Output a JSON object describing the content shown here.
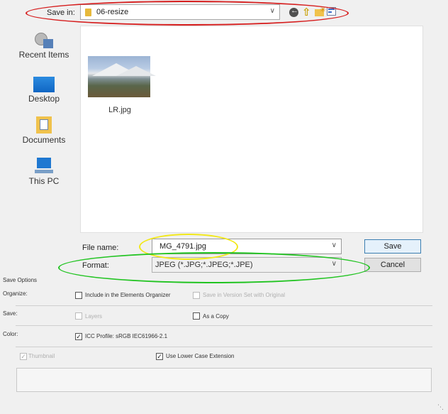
{
  "top": {
    "save_in_label": "Save in:",
    "folder": "06-resize"
  },
  "places": [
    {
      "label": "Recent Items"
    },
    {
      "label": "Desktop"
    },
    {
      "label": "Documents"
    },
    {
      "label": "This PC"
    }
  ],
  "files": [
    {
      "name": "LR.jpg"
    }
  ],
  "file_name": {
    "label": "File name:",
    "value": "MG_4791.jpg"
  },
  "format": {
    "label": "Format:",
    "value": "JPEG (*.JPG;*.JPEG;*.JPE)"
  },
  "buttons": {
    "save": "Save",
    "cancel": "Cancel"
  },
  "options": {
    "title": "Save Options",
    "organize_label": "Organize:",
    "include_elements": "Include in the Elements Organizer",
    "version_set": "Save in Version Set with Original",
    "save_label": "Save:",
    "layers": "Layers",
    "as_copy": "As a Copy",
    "color_label": "Color:",
    "icc_profile": "ICC Profile: sRGB IEC61966-2.1",
    "thumbnail": "Thumbnail",
    "lowercase_ext": "Use Lower Case Extension"
  },
  "annotations": {
    "red": "#d61d1d",
    "yellow": "#f2e81a",
    "green": "#22c422"
  }
}
